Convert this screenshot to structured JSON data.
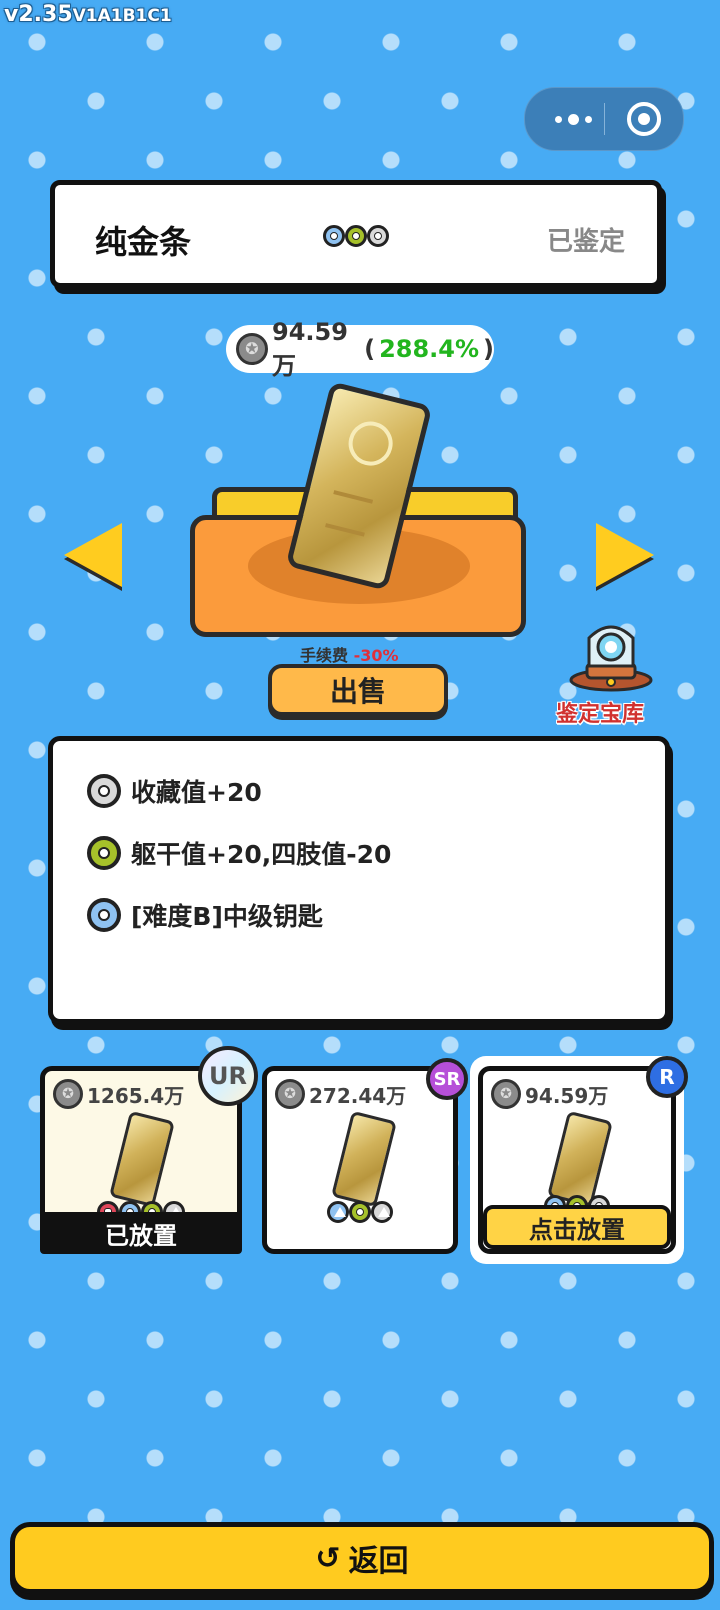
{
  "version": {
    "main": "v2.35",
    "sub": "V1A1B1C1"
  },
  "item": {
    "name": "纯金条",
    "status": "已鉴定",
    "price": "94.59万",
    "percent": "(288.4%)",
    "price_suffix": ")",
    "percent_value": "288.4%",
    "rarity_dots": [
      "blue",
      "green",
      "grey"
    ]
  },
  "sell": {
    "fee_label": "手续费",
    "fee_value": "-30%",
    "button_label": "出售"
  },
  "vault": {
    "label": "鉴定宝库"
  },
  "effects": [
    {
      "color": "grey",
      "text": "收藏值+20"
    },
    {
      "color": "green",
      "text": "躯干值+20,四肢值-20"
    },
    {
      "color": "blue",
      "text": "[难度B]中级钥匙"
    }
  ],
  "slots": [
    {
      "grade": "UR",
      "price": "1265.4万",
      "dots": [
        "red-pentagon",
        "blue",
        "green-diamond",
        "grey-triangle"
      ],
      "footer": "已放置"
    },
    {
      "grade": "SR",
      "price": "272.44万",
      "dots": [
        "blue-triangle",
        "green",
        "grey-triangle"
      ],
      "footer": ""
    },
    {
      "grade": "R",
      "price": "94.59万",
      "dots": [
        "blue",
        "green",
        "grey"
      ],
      "footer": "点击放置"
    }
  ],
  "back": {
    "icon": "↺",
    "label": "返回"
  },
  "colors": {
    "background": "#47abf4",
    "accent_yellow": "#ffcb1f",
    "sell_orange": "#ffb94a",
    "positive_green": "#22b51e",
    "negative_red": "#e0303a"
  },
  "icons": [
    "more-dots-icon",
    "target-icon",
    "coin-icon",
    "arrow-left-icon",
    "arrow-right-icon",
    "vault-icon",
    "undo-icon"
  ]
}
